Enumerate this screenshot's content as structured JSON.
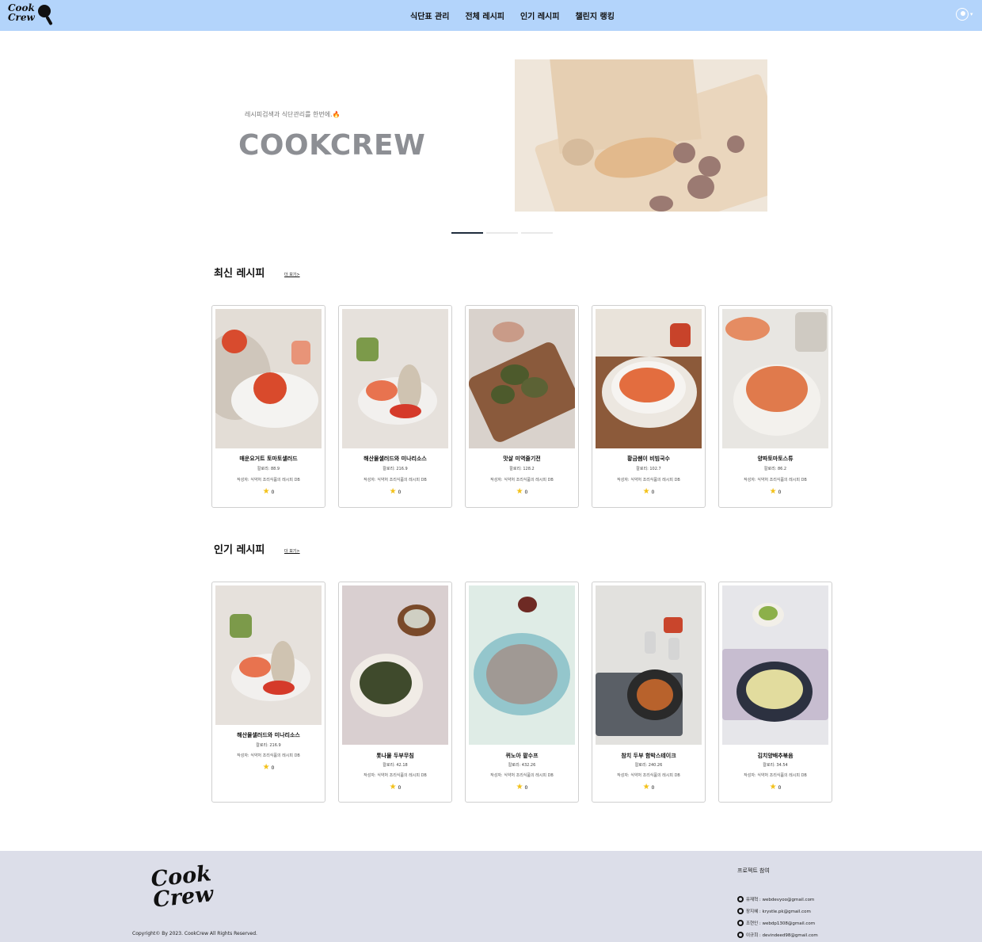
{
  "nav": {
    "logo_line1": "Cook",
    "logo_line2": "Crew",
    "menu": [
      "식단표 관리",
      "전체 레시피",
      "인기 레시피",
      "챌린지 랭킹"
    ],
    "user_caret": "▾"
  },
  "hero": {
    "subtitle": "레시피검색과 식단관리를 한번에.🔥",
    "title": "COOKCREW",
    "slides_total": 3,
    "active_slide": 1
  },
  "latest": {
    "title": "최신 레시피",
    "more": "더 보기>",
    "cards": [
      {
        "name": "매운요거트 토마토샐러드",
        "cal": "칼로리: 88.9",
        "author": "작성자: 식약처 조리식품의 레시피 DB",
        "rating": "0"
      },
      {
        "name": "해산물샐러드와 미나리소스",
        "cal": "칼로리: 216.9",
        "author": "작성자: 식약처 조리식품의 레시피 DB",
        "rating": "0"
      },
      {
        "name": "맛살 미역줄기전",
        "cal": "칼로리: 128.2",
        "author": "작성자: 식약처 조리식품의 레시피 DB",
        "rating": "0"
      },
      {
        "name": "황금쌤이 비빔국수",
        "cal": "칼로리: 102.7",
        "author": "작성자: 식약처 조리식품의 레시피 DB",
        "rating": "0"
      },
      {
        "name": "양파토마토스튜",
        "cal": "칼로리: 86.2",
        "author": "작성자: 식약처 조리식품의 레시피 DB",
        "rating": "0"
      }
    ]
  },
  "popular": {
    "title": "인기 레시피",
    "more": "더 보기>",
    "cards": [
      {
        "name": "해산물샐러드와 미나리소스",
        "cal": "칼로리: 216.9",
        "author": "작성자: 식약처 조리식품의 레시피 DB",
        "rating": "0"
      },
      {
        "name": "톳나물 두부무침",
        "cal": "칼로리: 42.18",
        "author": "작성자: 식약처 조리식품의 레시피 DB",
        "rating": "0"
      },
      {
        "name": "퀴노아 팥수프",
        "cal": "칼로리: 432.26",
        "author": "작성자: 식약처 조리식품의 레시피 DB",
        "rating": "0"
      },
      {
        "name": "참치 두부 함박스테이크",
        "cal": "칼로리: 240.26",
        "author": "작성자: 식약처 조리식품의 레시피 DB",
        "rating": "0"
      },
      {
        "name": "김치양배추볶음",
        "cal": "칼로리: 34.54",
        "author": "작성자: 식약처 조리식품의 레시피 DB",
        "rating": "0"
      }
    ]
  },
  "footer": {
    "logo_line1": "Cook",
    "logo_line2": "Crew",
    "copyright": "Copyright© By 2023. CookCrew All Rights Reserved.",
    "project_title": "프로젝트 참여",
    "members": [
      "유재혁 : webdevyoo@gmail.com",
      "장지혜 : krystle.pk@gmail.com",
      "조현인 : webdp1308@gmail.com",
      "이규희 : devindeed98@gmail.com"
    ]
  },
  "colors": {
    "nav_bg": "#b3d4fb",
    "footer_bg": "#dcdee9",
    "star": "#f3c118",
    "hero_title": "#8d8f94"
  }
}
